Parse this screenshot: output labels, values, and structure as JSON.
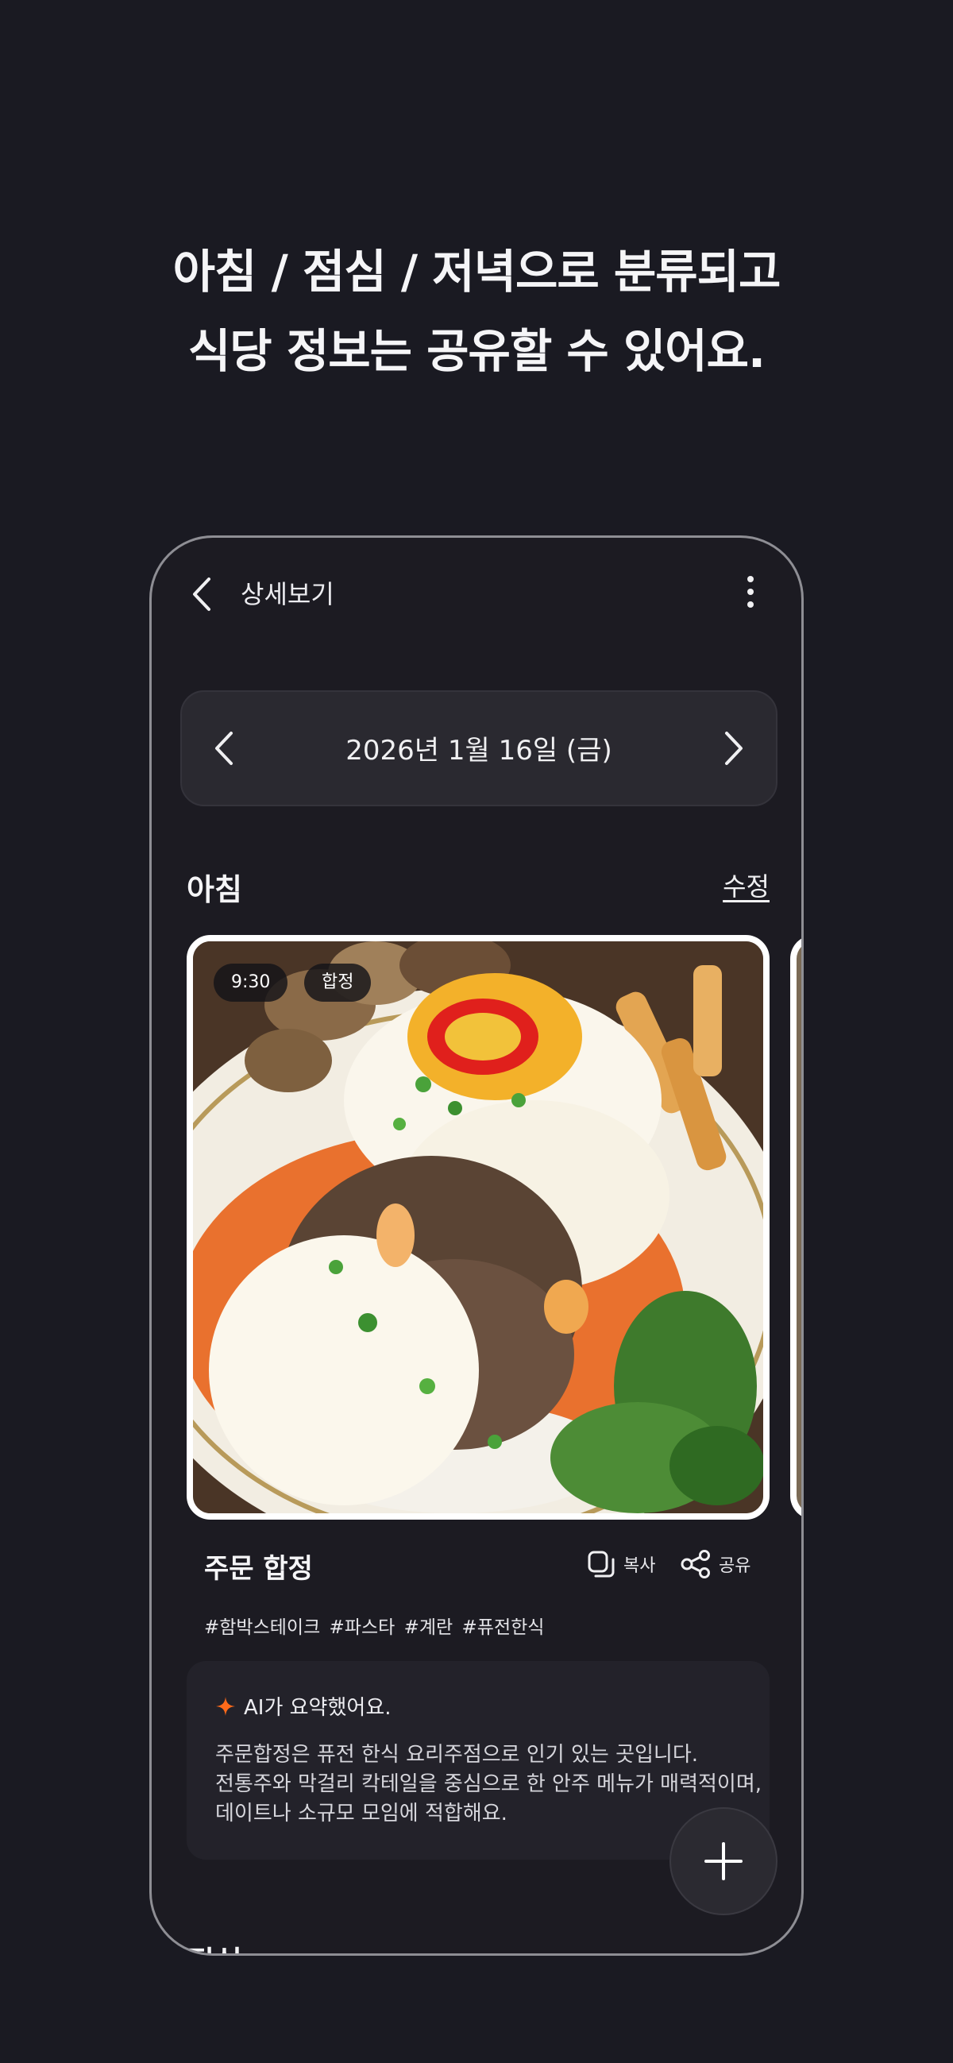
{
  "headline": {
    "line1": "아침 / 점심 / 저녁으로 분류되고",
    "line2": "식당 정보는 공유할 수 있어요."
  },
  "appbar": {
    "title": "상세보기",
    "back_icon": "chevron-left-icon",
    "more_icon": "more-vertical-icon"
  },
  "date_nav": {
    "date": "2026년 1월 16일 (금)",
    "prev_icon": "chevron-left-icon",
    "next_icon": "chevron-right-icon"
  },
  "section": {
    "title": "아침",
    "edit_label": "수정"
  },
  "meal_card": {
    "time": "9:30",
    "place_tag": "합정",
    "place_name": "주문 합정",
    "copy_label": "복사",
    "share_label": "공유",
    "hashtags": "#함박스테이크 #파스타 #계란 #퓨전한식"
  },
  "ai_summary": {
    "title": "AI가 요약했어요.",
    "lines": [
      "주문합정은 퓨전 한식 요리주점으로 인기 있는 곳입니다.",
      "전통주와 막걸리 칵테일을 중심으로 한 안주 메뉴가 매력적이며,",
      "데이트나 소규모 모임에 적합해요."
    ],
    "accent_color": "#ff6a1a"
  },
  "next_section": {
    "title": "점심"
  },
  "fab": {
    "icon": "plus-icon"
  },
  "colors": {
    "background": "#1a1a22",
    "phone_surface": "#1c1b22",
    "card_surface": "#2a2930"
  }
}
